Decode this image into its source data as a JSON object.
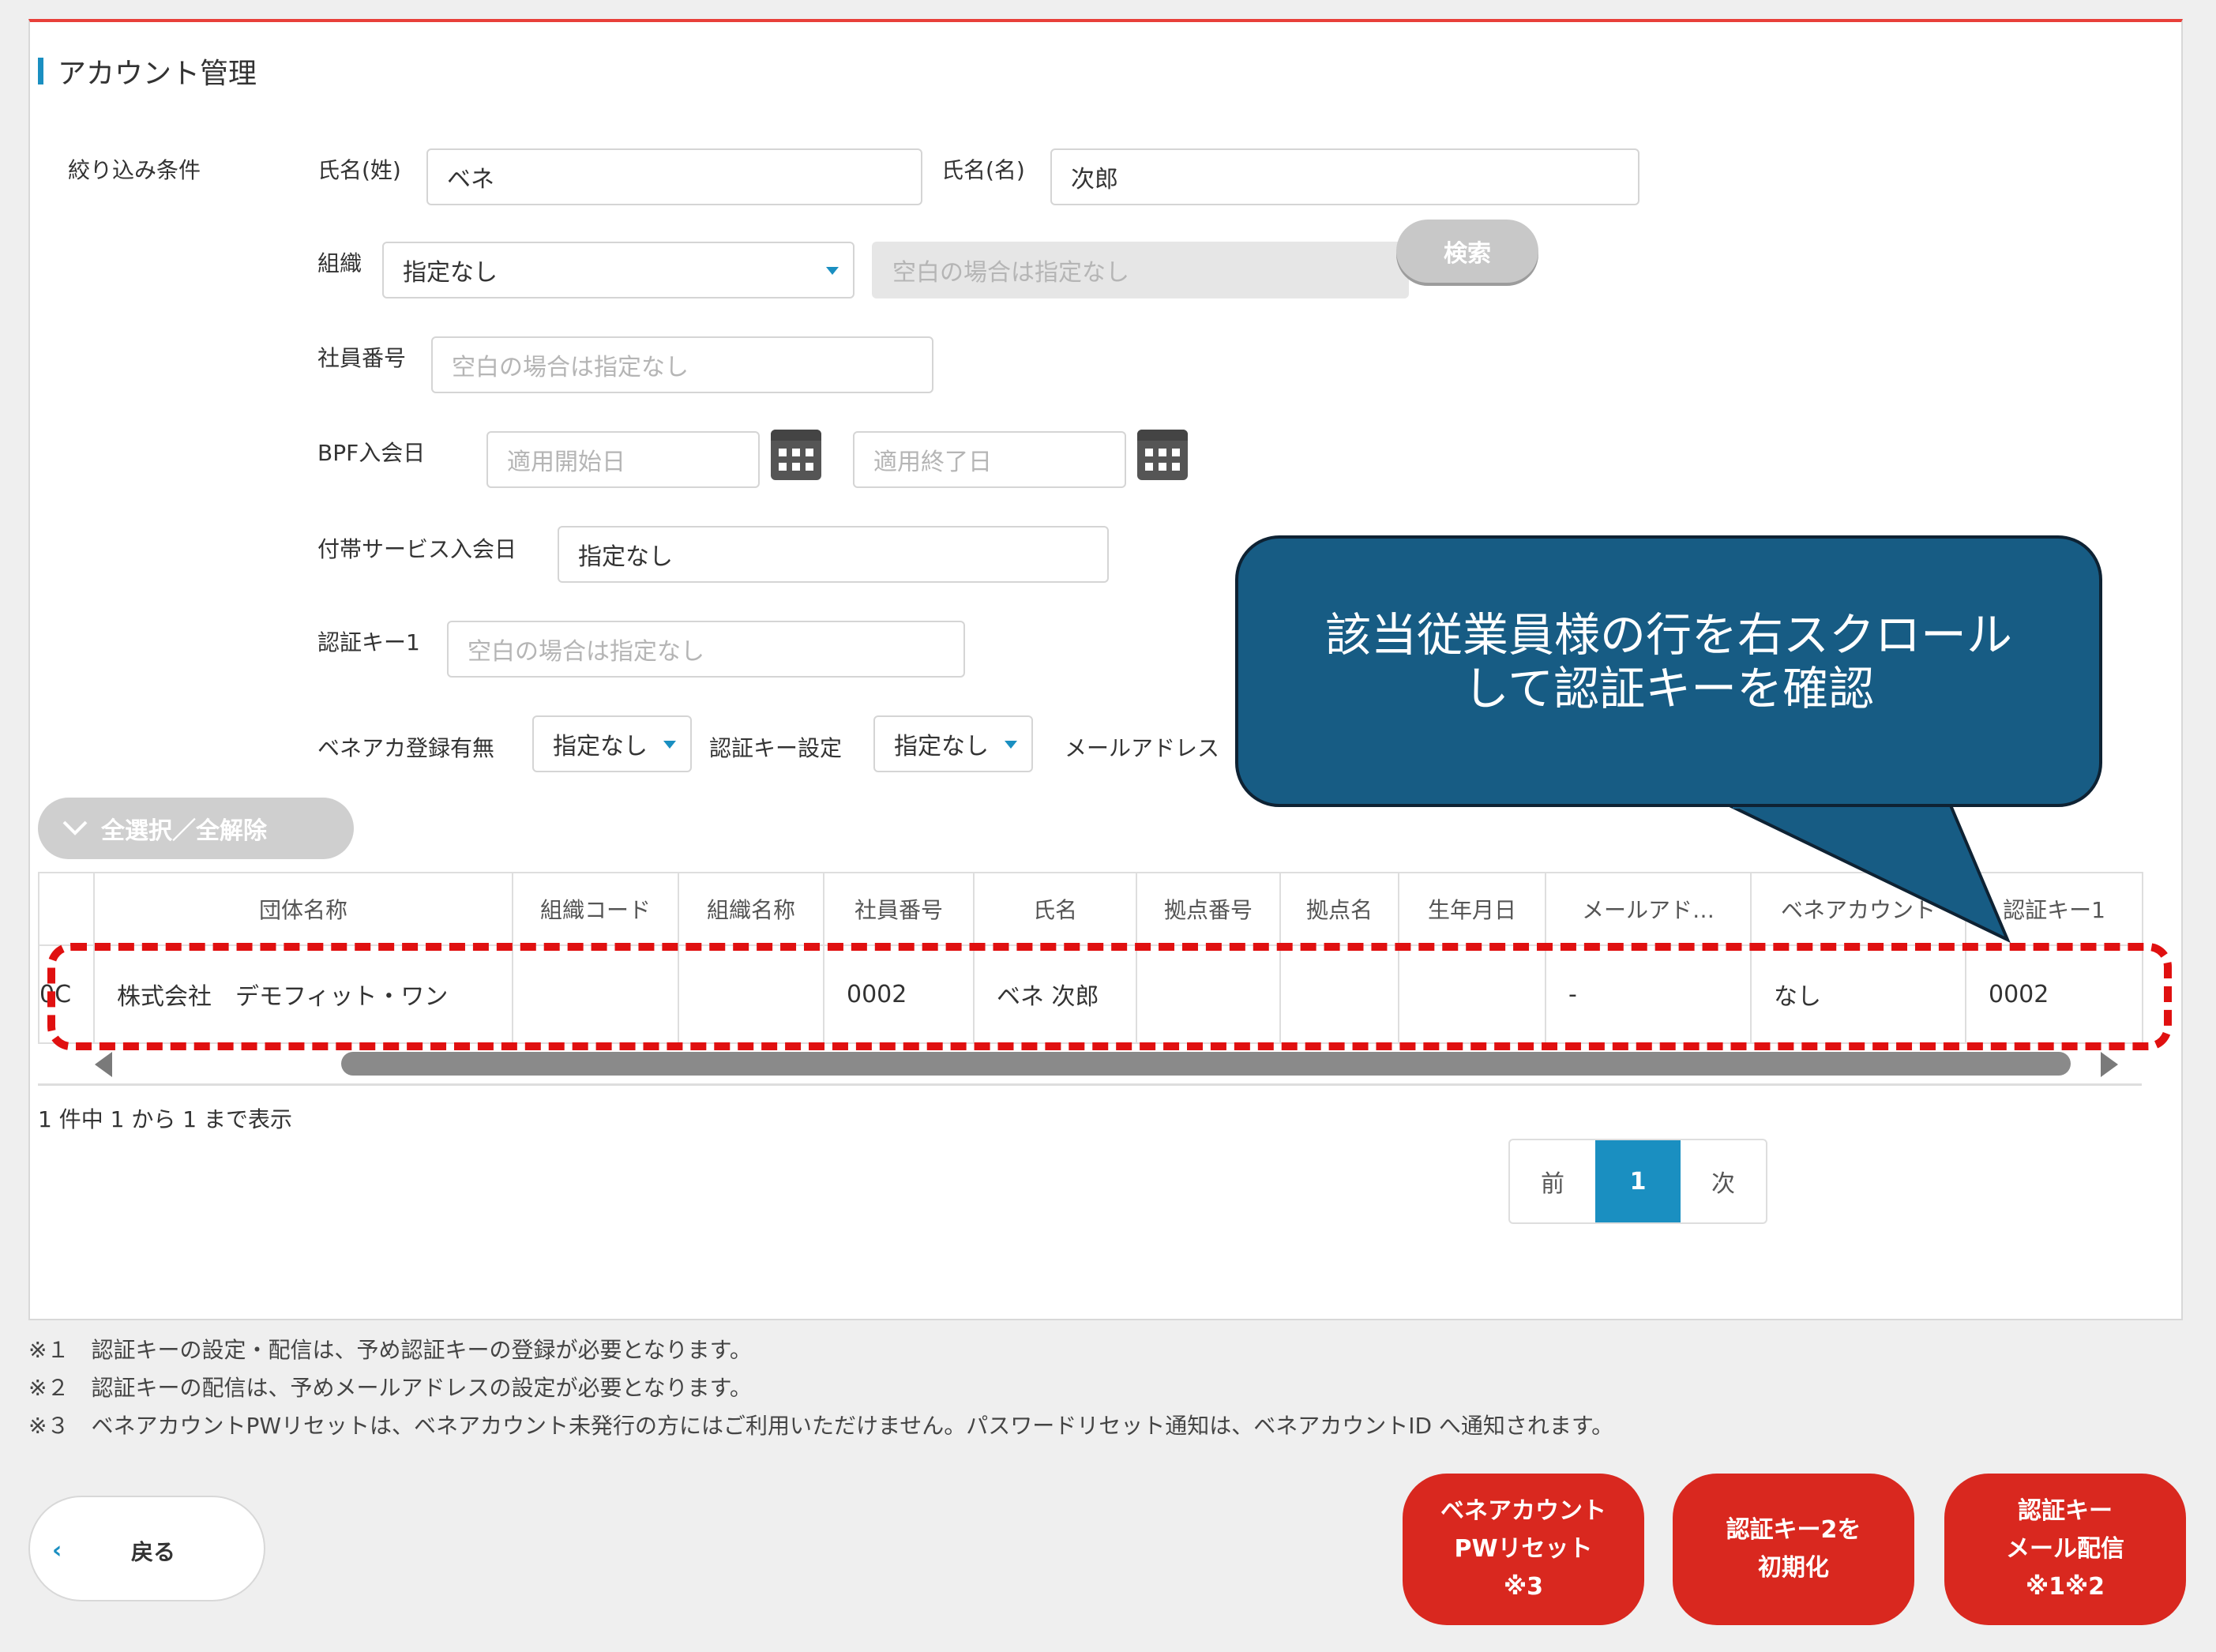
{
  "section": {
    "title": "アカウント管理"
  },
  "filters": {
    "label": "絞り込み条件",
    "last_name_label": "氏名(姓)",
    "last_name_value": "ベネ",
    "first_name_label": "氏名(名)",
    "first_name_value": "次郎",
    "org_label": "組織",
    "org_select": "指定なし",
    "org_input_placeholder": "空白の場合は指定なし",
    "search_button": "検索",
    "emp_no_label": "社員番号",
    "emp_no_placeholder": "空白の場合は指定なし",
    "bpf_label": "BPF入会日",
    "bpf_start_placeholder": "適用開始日",
    "bpf_end_placeholder": "適用終了日",
    "service_label": "付帯サービス入会日",
    "service_value": "指定なし",
    "auth_key1_label": "認証キー1",
    "auth_key1_placeholder": "空白の場合は指定なし",
    "bene_reg_label": "ベネアカ登録有無",
    "bene_reg_select": "指定なし",
    "auth_setting_label": "認証キー設定",
    "auth_setting_select": "指定なし",
    "email_label": "メールアドレス"
  },
  "select_all_button": "全選択／全解除",
  "table": {
    "headers": [
      "",
      "団体名称",
      "組織コード",
      "組織名称",
      "社員番号",
      "氏名",
      "拠点番号",
      "拠点名",
      "生年月日",
      "メールアド…",
      "ベネアカウント",
      "認証キー1"
    ],
    "row": [
      "0C",
      "株式会社　デモフィット・ワン",
      "",
      "",
      "0002",
      "ベネ 次郎",
      "",
      "",
      "",
      "-",
      "なし",
      "0002"
    ]
  },
  "result_count": "1 件中 1 から 1 まで表示",
  "pager": {
    "prev": "前",
    "current": "1",
    "next": "次"
  },
  "notes": [
    "※１　認証キーの設定・配信は、予め認証キーの登録が必要となります。",
    "※２　認証キーの配信は、予めメールアドレスの設定が必要となります。",
    "※３　ベネアカウントPWリセットは、ベネアカウント未発行の方にはご利用いただけません。パスワードリセット通知は、ベネアカウントID へ通知されます。"
  ],
  "back_button": "戻る",
  "action_buttons": {
    "pw_reset": [
      "ベネアカウント",
      "PWリセット",
      "※3"
    ],
    "init_key2": [
      "認証キー2を",
      "初期化"
    ],
    "mail_key": [
      "認証キー",
      "メール配信",
      "※1※2"
    ]
  },
  "callout": {
    "line1": "該当従業員様の行を右スクロール",
    "line2": "して認証キーを確認"
  },
  "colors": {
    "accent": "#1a8fc1",
    "danger": "#d9281f",
    "callout": "#175c84",
    "highlight": "#e01010"
  }
}
